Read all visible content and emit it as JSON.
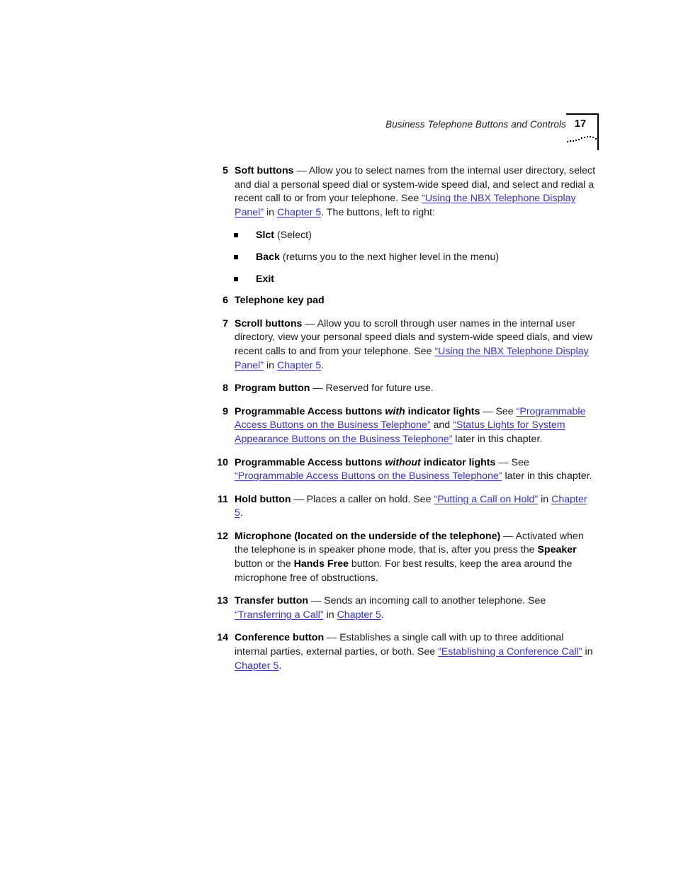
{
  "header": {
    "title": "Business Telephone Buttons and Controls",
    "page_number": "17"
  },
  "items": [
    {
      "number": "5",
      "lead": "Soft buttons",
      "dash": " — ",
      "text_1": "Allow you to select names from the internal user directory, select and dial a personal speed dial or system-wide speed dial, and select and redial a recent call to or from your telephone. See ",
      "link_1": "“Using the NBX Telephone Display Panel”",
      "text_2": " in ",
      "link_2": "Chapter 5",
      "text_3": ". The buttons, left to right:"
    },
    {
      "number": "6",
      "lead": "Telephone key pad",
      "dash": "",
      "text_1": ""
    },
    {
      "number": "7",
      "lead": "Scroll buttons",
      "dash": " — ",
      "text_1": "Allow you to scroll through user names in the internal user directory, view your personal speed dials and system-wide speed dials, and view recent calls to and from your telephone. See ",
      "link_1": "“Using the NBX Telephone Display Panel”",
      "text_2": " in ",
      "link_2": "Chapter 5",
      "text_3": "."
    },
    {
      "number": "8",
      "lead": "Program button",
      "dash": " — ",
      "text_1": "Reserved for future use."
    },
    {
      "number": "9",
      "lead_a": "Programmable Access buttons ",
      "lead_em": "with",
      "lead_b": " indicator lights",
      "dash": " — ",
      "text_1": "See ",
      "link_1": "“Programmable Access Buttons on the Business Telephone”",
      "text_2": " and ",
      "link_2": "“Status Lights for System Appearance Buttons on the Business Telephone”",
      "text_3": " later in this chapter."
    },
    {
      "number": "10",
      "lead_a": "Programmable Access buttons ",
      "lead_em": "without",
      "lead_b": " indicator lights",
      "dash": " — ",
      "text_1": "See ",
      "link_1": "“Programmable Access Buttons on the Business Telephone”",
      "text_2": " later in this chapter."
    },
    {
      "number": "11",
      "lead": "Hold button",
      "dash": " — ",
      "text_1": "Places a caller on hold. See ",
      "link_1": "“Putting a Call on Hold”",
      "text_2": " in ",
      "link_2": "Chapter 5",
      "text_3": "."
    },
    {
      "number": "12",
      "lead": "Microphone (located on the underside of the telephone)",
      "dash": " — ",
      "text_1": "Activated when the telephone is in speaker phone mode, that is, after you press the ",
      "bold_1": "Speaker",
      "text_2": " button or the ",
      "bold_2": "Hands Free",
      "text_3": " button. For best results, keep the area around the microphone free of obstructions."
    },
    {
      "number": "13",
      "lead": "Transfer button",
      "dash": " — ",
      "text_1": "Sends an incoming call to another telephone. See ",
      "link_1": "“Transferring a Call”",
      "text_2": " in ",
      "link_2": "Chapter 5",
      "text_3": "."
    },
    {
      "number": "14",
      "lead": "Conference button",
      "dash": " — ",
      "text_1": "Establishes a single call with up to three additional internal parties, external parties, or both. See ",
      "link_1": "“Establishing a Conference Call”",
      "text_2": " in ",
      "link_2": "Chapter 5",
      "text_3": "."
    }
  ],
  "bullets": [
    {
      "lead": "Slct",
      "text": " (Select)"
    },
    {
      "lead": "Back",
      "text": " (returns you to the next higher level in the menu)"
    },
    {
      "lead": "Exit",
      "text": ""
    }
  ],
  "colors": {
    "link": "#3333cc",
    "body_text": "#1a1a1a",
    "rule": "#000000"
  }
}
